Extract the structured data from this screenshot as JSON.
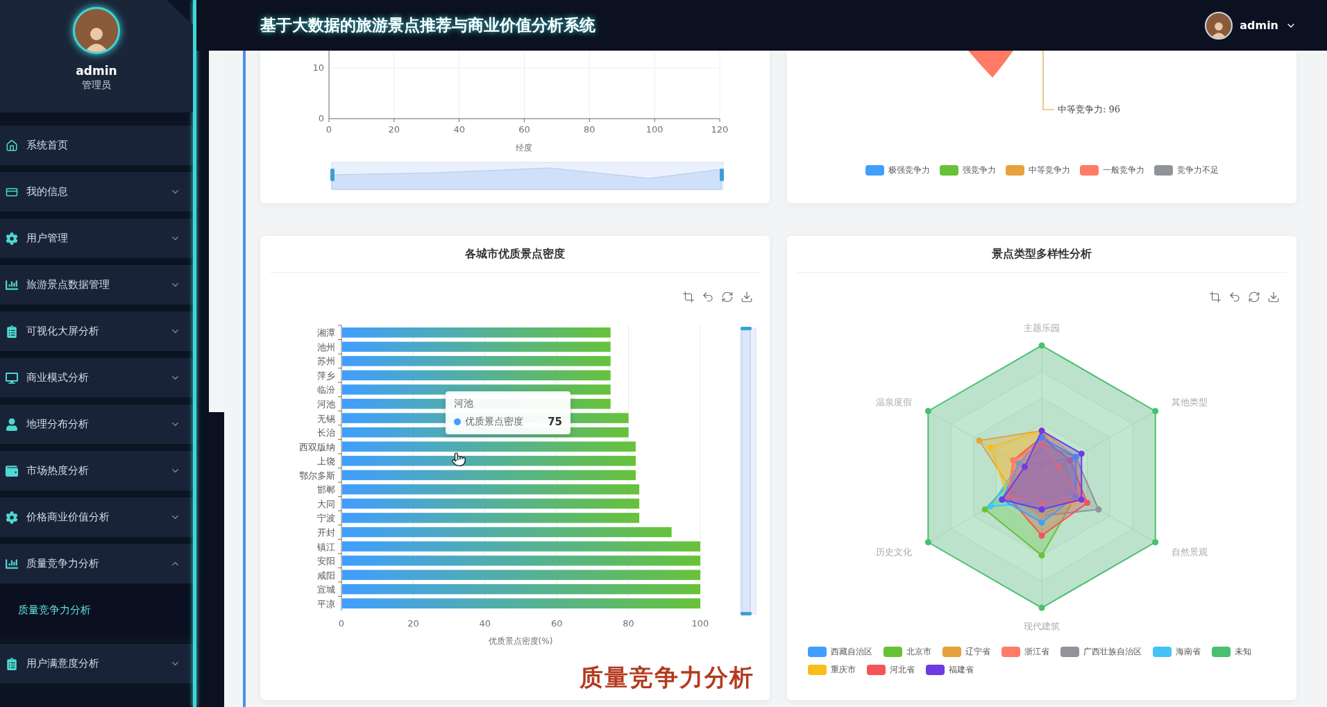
{
  "header": {
    "title": "基于大数据的旅游景点推荐与商业价值分析系统",
    "user": "admin"
  },
  "sidebar": {
    "user": {
      "name": "admin",
      "role": "管理员"
    },
    "items": [
      {
        "label": "系统首页",
        "kind": "link"
      },
      {
        "label": "我的信息",
        "kind": "menu",
        "expanded": false
      },
      {
        "label": "用户管理",
        "kind": "menu",
        "expanded": false
      },
      {
        "label": "旅游景点数据管理",
        "kind": "menu",
        "expanded": false
      },
      {
        "label": "可视化大屏分析",
        "kind": "menu",
        "expanded": false
      },
      {
        "label": "商业模式分析",
        "kind": "menu",
        "expanded": false
      },
      {
        "label": "地理分布分析",
        "kind": "menu",
        "expanded": false
      },
      {
        "label": "市场热度分析",
        "kind": "menu",
        "expanded": false
      },
      {
        "label": "价格商业价值分析",
        "kind": "menu",
        "expanded": false
      },
      {
        "label": "质量竞争力分析",
        "kind": "menu",
        "expanded": true,
        "children": [
          {
            "label": "质量竞争力分析",
            "selected": true
          }
        ]
      },
      {
        "label": "用户满意度分析",
        "kind": "menu",
        "expanded": false
      }
    ]
  },
  "scatter_card": {
    "chart_data": {
      "type": "scatter",
      "xlabel": "经度",
      "xlim": [
        0,
        120
      ],
      "ylim": [
        0,
        10
      ],
      "xticks": [
        0,
        20,
        40,
        60,
        80,
        100,
        120
      ],
      "yticks": [
        0,
        10
      ],
      "grid": true
    }
  },
  "pie_card": {
    "callout": "中等竞争力: 96",
    "legend": [
      {
        "label": "极强竞争力",
        "color": "#409eff"
      },
      {
        "label": "强竞争力",
        "color": "#67c23a"
      },
      {
        "label": "中等竞争力",
        "color": "#e6a23c"
      },
      {
        "label": "一般竞争力",
        "color": "#ff7b66"
      },
      {
        "label": "竞争力不足",
        "color": "#909399"
      }
    ]
  },
  "bar_card": {
    "title": "各城市优质景点密度",
    "chart_data": {
      "type": "bar",
      "orientation": "horizontal",
      "xlabel": "优质景点密度(%)",
      "categories": [
        "湘潭",
        "池州",
        "苏州",
        "萍乡",
        "临汾",
        "河池",
        "无锡",
        "长治",
        "西双版纳",
        "上饶",
        "鄂尔多斯",
        "邯郸",
        "大同",
        "宁波",
        "开封",
        "镇江",
        "安阳",
        "咸阳",
        "宣城",
        "平凉"
      ],
      "values": [
        75,
        75,
        75,
        75,
        75,
        75,
        80,
        80,
        82,
        82,
        82,
        83,
        83,
        83,
        92,
        100,
        100,
        100,
        100,
        100
      ],
      "xlim": [
        0,
        100
      ],
      "xticks": [
        0,
        20,
        40,
        60,
        80,
        100
      ],
      "grid": true
    },
    "tooltip": {
      "title": "河池",
      "label": "优质景点密度",
      "value": "75"
    },
    "caption": "质量竞争力分析"
  },
  "radar_card": {
    "title": "景点类型多样性分析",
    "indicators": [
      "主题乐园",
      "其他类型",
      "自然景观",
      "现代建筑",
      "历史文化",
      "温泉度假"
    ],
    "legend": [
      {
        "label": "西藏自治区",
        "color": "#409eff"
      },
      {
        "label": "北京市",
        "color": "#67c23a"
      },
      {
        "label": "辽宁省",
        "color": "#e6a23c"
      },
      {
        "label": "浙江省",
        "color": "#ff7b66"
      },
      {
        "label": "广西壮族自治区",
        "color": "#909399"
      },
      {
        "label": "海南省",
        "color": "#45c2f8"
      },
      {
        "label": "未知",
        "color": "#47c16e"
      },
      {
        "label": "重庆市",
        "color": "#fbbd1c"
      },
      {
        "label": "河北省",
        "color": "#f5535a"
      },
      {
        "label": "福建省",
        "color": "#6e3ae6"
      }
    ]
  }
}
